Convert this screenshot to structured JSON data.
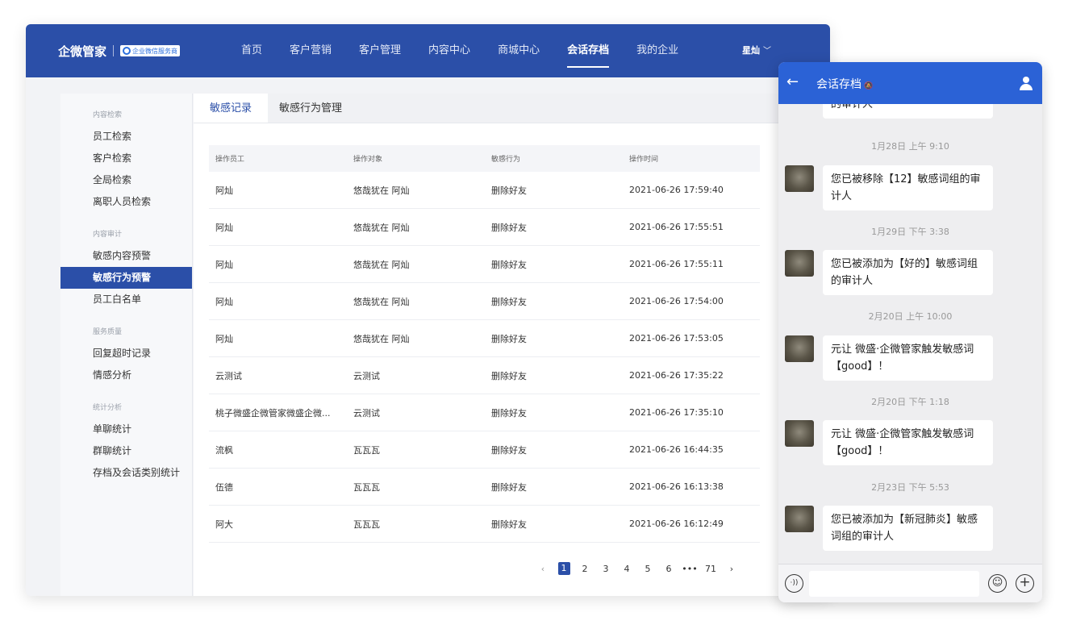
{
  "header": {
    "brand": "企微管家",
    "badge": "企业微信服务商",
    "nav": [
      "首页",
      "客户营销",
      "客户管理",
      "内容中心",
      "商城中心",
      "会话存档",
      "我的企业"
    ],
    "active_nav": "会话存档",
    "user": "星灿",
    "user_chevron": "﹀"
  },
  "sidebar": {
    "groups": [
      {
        "title": "内容检索",
        "items": [
          "员工检索",
          "客户检索",
          "全局检索",
          "离职人员检索"
        ]
      },
      {
        "title": "内容审计",
        "items": [
          "敏感内容预警",
          "敏感行为预警",
          "员工白名单"
        ]
      },
      {
        "title": "服务质量",
        "items": [
          "回复超时记录",
          "情感分析"
        ]
      },
      {
        "title": "统计分析",
        "items": [
          "单聊统计",
          "群聊统计",
          "存档及会话类别统计"
        ]
      }
    ],
    "active_item": "敏感行为预警"
  },
  "tabs": [
    "敏感记录",
    "敏感行为管理"
  ],
  "table": {
    "headers": [
      "操作员工",
      "操作对象",
      "敏感行为",
      "操作时间"
    ],
    "rows": [
      [
        "阿灿",
        "悠哉犹在 阿灿",
        "删除好友",
        "2021-06-26 17:59:40"
      ],
      [
        "阿灿",
        "悠哉犹在 阿灿",
        "删除好友",
        "2021-06-26 17:55:51"
      ],
      [
        "阿灿",
        "悠哉犹在 阿灿",
        "删除好友",
        "2021-06-26 17:55:11"
      ],
      [
        "阿灿",
        "悠哉犹在 阿灿",
        "删除好友",
        "2021-06-26 17:54:00"
      ],
      [
        "阿灿",
        "悠哉犹在 阿灿",
        "删除好友",
        "2021-06-26 17:53:05"
      ],
      [
        "云测试",
        "云测试",
        "删除好友",
        "2021-06-26 17:35:22"
      ],
      [
        "桃子微盛企微管家微盛企微...",
        "云测试",
        "删除好友",
        "2021-06-26 17:35:10"
      ],
      [
        "流枫",
        "瓦瓦瓦",
        "删除好友",
        "2021-06-26 16:44:35"
      ],
      [
        "伍德",
        "瓦瓦瓦",
        "删除好友",
        "2021-06-26 16:13:38"
      ],
      [
        "阿大",
        "瓦瓦瓦",
        "删除好友",
        "2021-06-26 16:12:49"
      ]
    ]
  },
  "pagination": {
    "prev": "‹",
    "pages": [
      "1",
      "2",
      "3",
      "4",
      "5",
      "6",
      "•••",
      "71"
    ],
    "current": "1",
    "next": "›"
  },
  "chat_panel": {
    "back": "←",
    "title": "会话存档",
    "mute_icon": "🔕",
    "cut_message": "的审计人",
    "messages": [
      {
        "time": "1月28日 上午 9:10",
        "text": "您已被移除【12】敏感词组的审计人"
      },
      {
        "time": "1月29日 下午 3:38",
        "text": "您已被添加为【好的】敏感词组的审计人"
      },
      {
        "time": "2月20日 上午 10:00",
        "text": "元让 微盛·企微管家触发敏感词【good】！"
      },
      {
        "time": "2月20日 下午 1:18",
        "text": "元让 微盛·企微管家触发敏感词【good】！"
      },
      {
        "time": "2月23日 下午 5:53",
        "text": "您已被添加为【新冠肺炎】敏感词组的审计人"
      }
    ],
    "voice_icon": "·))",
    "emoji_icon": "☺",
    "plus_icon": "+"
  }
}
